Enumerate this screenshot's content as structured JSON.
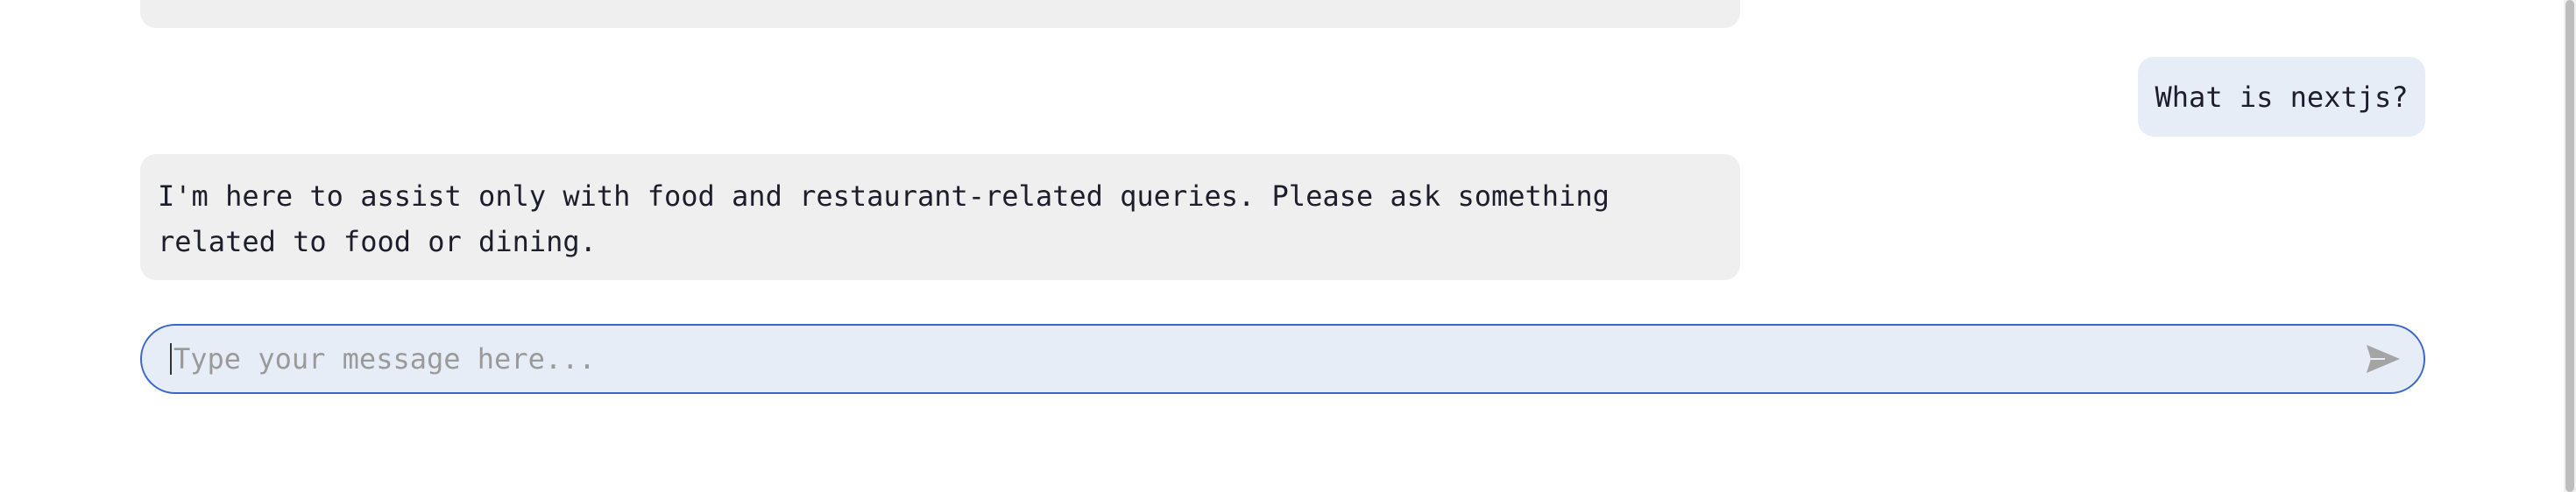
{
  "chat": {
    "messages": [
      {
        "role": "user",
        "text": "What is nextjs?"
      },
      {
        "role": "assistant",
        "text": "I'm here to assist only with food and restaurant-related queries. Please ask something\nrelated to food or dining."
      }
    ]
  },
  "input": {
    "placeholder": "Type your message here...",
    "value": "",
    "send_icon": "send-icon"
  },
  "colors": {
    "assistant_bubble": "#efefef",
    "user_bubble": "#e7edf6",
    "input_border": "#3a67c8",
    "send_icon": "#a4a4a4"
  }
}
